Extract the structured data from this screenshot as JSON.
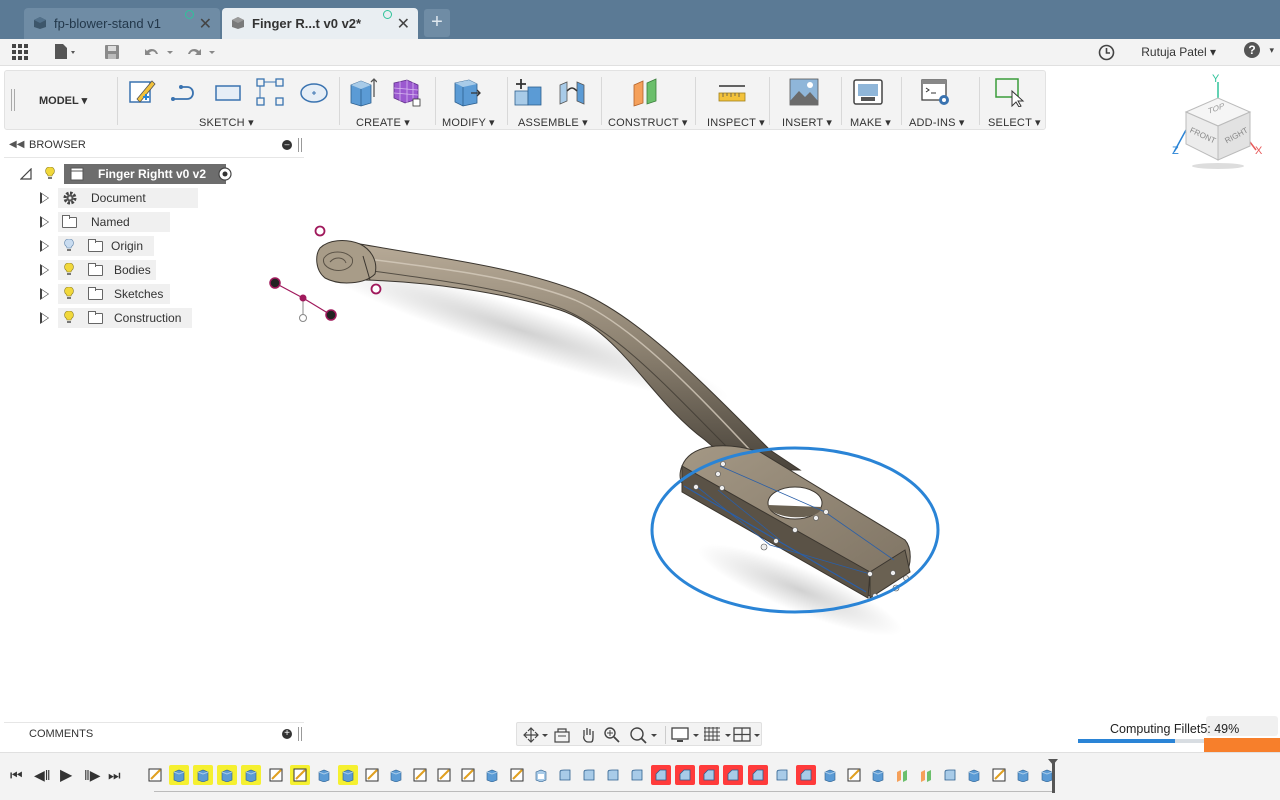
{
  "tabs": [
    {
      "label": "fp-blower-stand v1",
      "active": false
    },
    {
      "label": "Finger R...t v0 v2*",
      "active": true
    }
  ],
  "quickbar": {
    "user_name": "Rutuja Patel",
    "help_label": "?"
  },
  "toolbar": {
    "workspace": "MODEL",
    "groups": [
      {
        "label": "SKETCH",
        "icons": [
          "create-sketch-icon",
          "line-icon",
          "rectangle-icon",
          "pattern-icon",
          "ellipse-icon"
        ]
      },
      {
        "label": "CREATE",
        "icons": [
          "extrude-icon",
          "form-icon"
        ]
      },
      {
        "label": "MODIFY",
        "icons": [
          "press-pull-icon"
        ]
      },
      {
        "label": "ASSEMBLE",
        "icons": [
          "new-component-icon",
          "joint-icon"
        ]
      },
      {
        "label": "CONSTRUCT",
        "icons": [
          "offset-plane-icon"
        ]
      },
      {
        "label": "INSPECT",
        "icons": [
          "measure-icon"
        ]
      },
      {
        "label": "INSERT",
        "icons": [
          "insert-image-icon"
        ]
      },
      {
        "label": "MAKE",
        "icons": [
          "3d-print-icon"
        ]
      },
      {
        "label": "ADD-INS",
        "icons": [
          "scripts-icon"
        ]
      },
      {
        "label": "SELECT",
        "icons": [
          "select-icon"
        ]
      }
    ]
  },
  "viewcube": {
    "top": "TOP",
    "front": "FRONT",
    "right": "RIGHT",
    "axis_x": "X",
    "axis_y": "Y",
    "axis_z": "Z"
  },
  "browser": {
    "title": "BROWSER",
    "root": "Finger Rightt v0 v2",
    "nodes": [
      {
        "label": "Document Settings",
        "icon": "gear-icon"
      },
      {
        "label": "Named Views",
        "icon": "folder-icon"
      },
      {
        "label": "Origin",
        "icon": "folder-icon",
        "bulb": "off"
      },
      {
        "label": "Bodies",
        "icon": "folder-icon",
        "bulb": "on"
      },
      {
        "label": "Sketches",
        "icon": "folder-icon",
        "bulb": "on"
      },
      {
        "label": "Construction",
        "icon": "folder-icon",
        "bulb": "on"
      }
    ]
  },
  "comments": {
    "title": "COMMENTS"
  },
  "status": {
    "computing_label": "Computing Fillet5: 49%",
    "progress": 0.49
  },
  "colors": {
    "tab_bar": "#5b7a95",
    "accent_blue": "#2a84d6",
    "highlight_yellow": "#f5f030",
    "highlight_red": "#ff3b3b",
    "progress_orange": "#f77f2b"
  },
  "timeline": {
    "features": [
      "sketch",
      "extrude",
      "extrude",
      "extrude",
      "extrude",
      "sketch",
      "sketch",
      "extrude",
      "extrude",
      "sketch",
      "extrude",
      "sketch",
      "sketch",
      "sketch",
      "extrude",
      "sketch",
      "shell",
      "fillet",
      "fillet",
      "fillet",
      "fillet",
      "chamfer",
      "chamfer",
      "chamfer",
      "chamfer",
      "chamfer",
      "fillet",
      "chamfer",
      "extrude",
      "sketch",
      "extrude",
      "plane",
      "plane",
      "fillet",
      "extrude",
      "sketch",
      "extrude",
      "extrude"
    ],
    "highlights": [
      "none",
      "yellow",
      "yellow",
      "yellow",
      "yellow",
      "none",
      "yellow",
      "none",
      "yellow",
      "none",
      "none",
      "none",
      "none",
      "none",
      "none",
      "none",
      "none",
      "none",
      "none",
      "none",
      "none",
      "red",
      "red",
      "red",
      "red",
      "red",
      "none",
      "red",
      "none",
      "none",
      "none",
      "none",
      "none",
      "none",
      "none",
      "none",
      "none",
      "none"
    ]
  }
}
